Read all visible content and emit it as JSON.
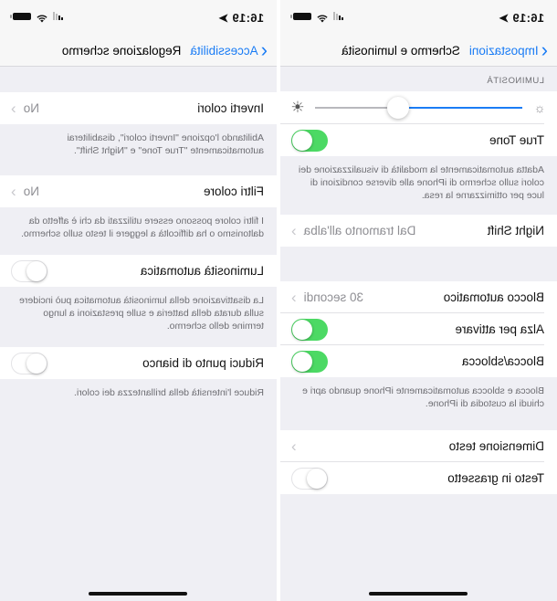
{
  "mirrored": true,
  "accent_color": "#1a7cf5",
  "toggle_on_color": "#4cd964",
  "panels": {
    "display": {
      "status": {
        "time": "16:19",
        "location_icon": "location-arrow-icon"
      },
      "nav": {
        "back_label": "Impostazioni",
        "title": "Schermo e luminosità"
      },
      "brightness": {
        "header": "LUMINOSITÀ",
        "level_percent": 60
      },
      "true_tone": {
        "label": "True Tone",
        "on": true,
        "footer": "Adatta automaticamente la modalità di visualizzazione dei colori sullo schermo di iPhone alle diverse condizioni di luce per ottimizzarne la resa."
      },
      "night_shift": {
        "label": "Night Shift",
        "value": "Dal tramonto all'alba"
      },
      "auto_lock": {
        "label": "Blocco automatico",
        "value": "30 secondi"
      },
      "raise_to_wake": {
        "label": "Alza per attivare",
        "on": true
      },
      "lock_unlock": {
        "label": "Blocca/sblocca",
        "on": true,
        "footer": "Blocca e sblocca automaticamente iPhone quando apri e chiudi la custodia di iPhone."
      },
      "text_size": {
        "label": "Dimensione testo"
      },
      "bold_text": {
        "label": "Testo in grassetto",
        "on": false
      }
    },
    "accommodations": {
      "status": {
        "time": "16:19",
        "location_icon": "location-arrow-icon"
      },
      "nav": {
        "back_label": "Accessibilità",
        "title": "Regolazione schermo"
      },
      "invert": {
        "label": "Inverti colori",
        "value": "No",
        "footer": "Abilitando l'opzione \"Inverti colori\", disabiliterai automaticamente \"True Tone\" e \"Night Shift\"."
      },
      "filters": {
        "label": "Filtri colore",
        "value": "No",
        "footer": "I filtri colore possono essere utilizzati da chi è affetto da daltonismo o ha difficoltà a leggere il testo sullo schermo."
      },
      "auto_brightness": {
        "label": "Luminosità automatica",
        "on": false,
        "footer": "La disattivazione della luminosità automatica può incidere sulla durata della batteria e sulle prestazioni a lungo termine dello schermo."
      },
      "white_point": {
        "label": "Riduci punto di bianco",
        "on": false,
        "footer": "Riduce l'intensità della brillantezza dei colori."
      }
    }
  }
}
